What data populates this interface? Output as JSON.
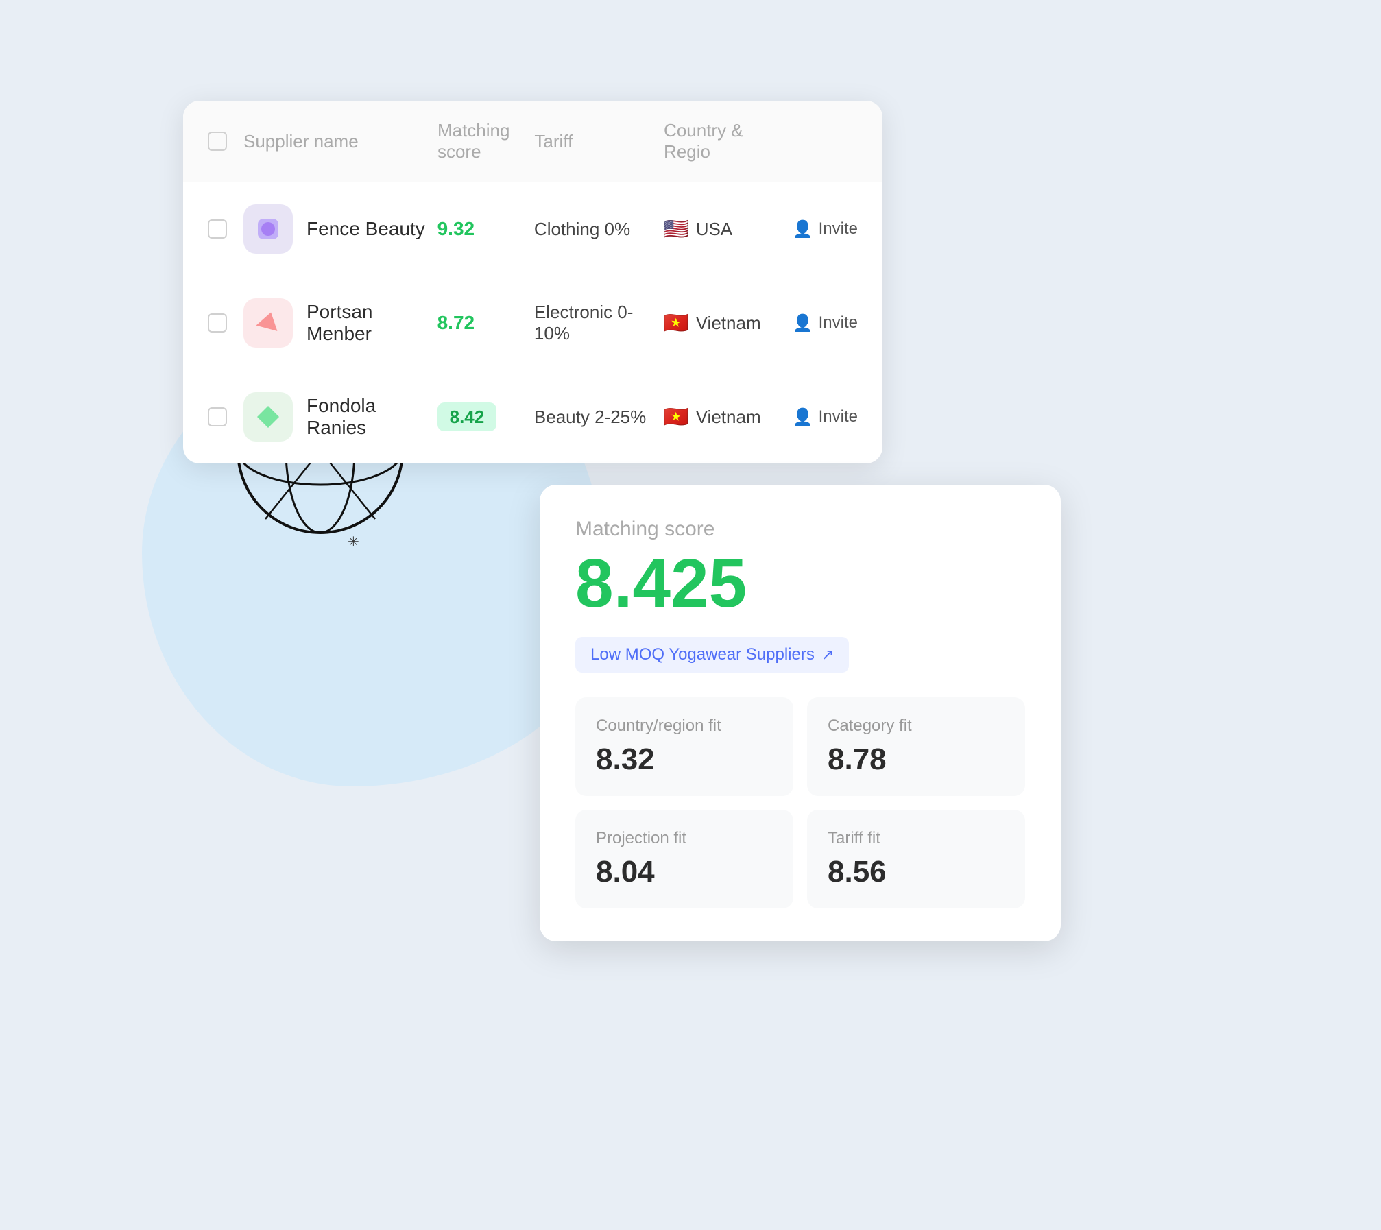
{
  "table": {
    "headers": {
      "checkbox": "",
      "supplier": "Supplier name",
      "matching": "Matching score",
      "tariff": "Tariff",
      "country": "Country & Regio"
    },
    "rows": [
      {
        "id": "fence-beauty",
        "name": "Fence Beauty",
        "score": "9.32",
        "scoreBadge": false,
        "tariff": "Clothing 0%",
        "countryFlag": "🇺🇸",
        "country": "USA",
        "action": "Invite",
        "avatarType": "fb"
      },
      {
        "id": "portsan-menber",
        "name": "Portsan Menber",
        "score": "8.72",
        "scoreBadge": false,
        "tariff": "Electronic 0-10%",
        "countryFlag": "🇻🇳",
        "country": "Vietnam",
        "action": "Invite",
        "avatarType": "pm"
      },
      {
        "id": "fondola-ranies",
        "name": "Fondola Ranies",
        "score": "8.42",
        "scoreBadge": true,
        "tariff": "Beauty 2-25%",
        "countryFlag": "🇻🇳",
        "country": "Vietnam",
        "action": "Invite",
        "avatarType": "fr"
      }
    ]
  },
  "scoreCard": {
    "label": "Matching score",
    "value": "8.425",
    "linkText": "Low MOQ Yogawear Suppliers",
    "linkArrow": "↗",
    "fits": [
      {
        "id": "country",
        "label": "Country/region fit",
        "value": "8.32"
      },
      {
        "id": "category",
        "label": "Category fit",
        "value": "8.78"
      },
      {
        "id": "projection",
        "label": "Projection fit",
        "value": "8.04"
      },
      {
        "id": "tariff",
        "label": "Tariff fit",
        "value": "8.56"
      }
    ]
  },
  "icons": {
    "inviteIcon": "👤",
    "checkboxEmpty": ""
  }
}
